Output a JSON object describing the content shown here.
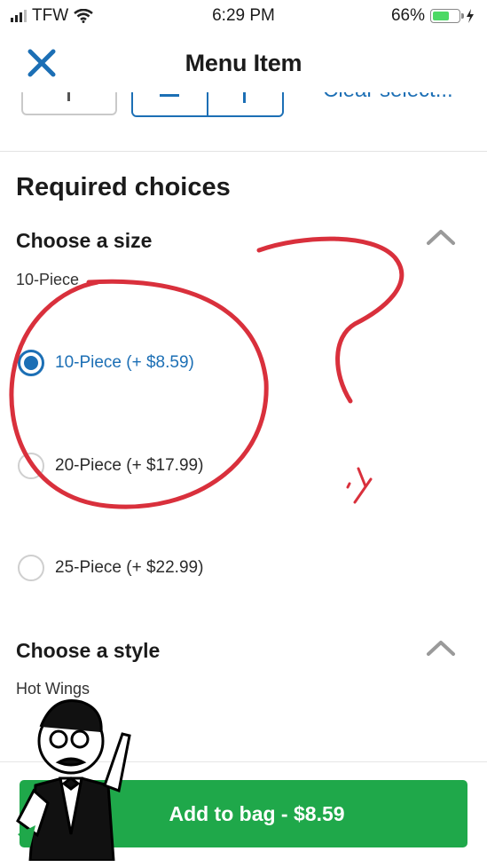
{
  "status_bar": {
    "carrier": "TFW",
    "time": "6:29 PM",
    "battery_percent": "66%",
    "battery_level": 0.66,
    "battery_color": "#4cd964"
  },
  "nav": {
    "title": "Menu Item",
    "close_icon": "close-icon"
  },
  "quantity_row": {
    "clear_label": "Clear select..."
  },
  "required_choices": {
    "title": "Required choices",
    "groups": [
      {
        "title": "Choose a size",
        "subtitle": "10-Piece",
        "options": [
          {
            "label": "10-Piece (+ $8.59)",
            "selected": true
          },
          {
            "label": "20-Piece (+ $17.99)",
            "selected": false
          },
          {
            "label": "25-Piece (+ $22.99)",
            "selected": false
          }
        ]
      },
      {
        "title": "Choose a style",
        "subtitle": "Hot Wings"
      }
    ]
  },
  "bottom": {
    "add_button_label": "Add to bag - $8.59",
    "accent_color": "#1fa84a"
  },
  "colors": {
    "link_blue": "#1c6fb5",
    "annotation_red": "#d9303c"
  }
}
